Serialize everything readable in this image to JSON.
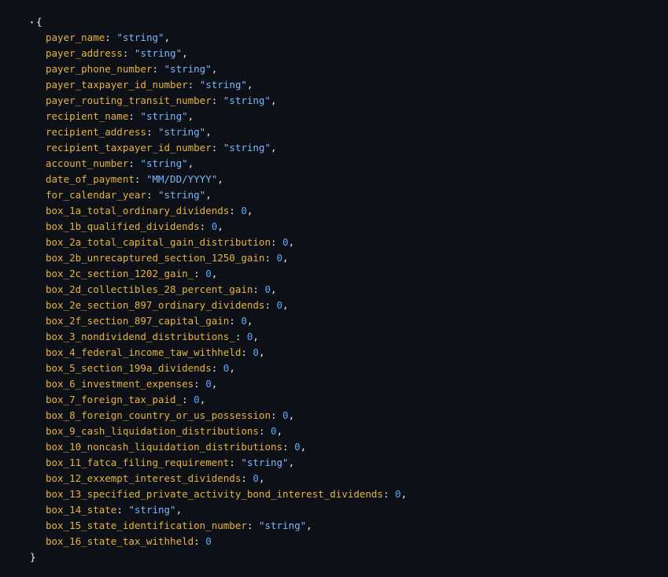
{
  "viewer": {
    "toggle_icon": "caret-down-icon",
    "open_brace": "{",
    "close_brace": "}",
    "properties": [
      {
        "key": "payer_name",
        "value": "\"string\"",
        "type": "string"
      },
      {
        "key": "payer_address",
        "value": "\"string\"",
        "type": "string"
      },
      {
        "key": "payer_phone_number",
        "value": "\"string\"",
        "type": "string"
      },
      {
        "key": "payer_taxpayer_id_number",
        "value": "\"string\"",
        "type": "string"
      },
      {
        "key": "payer_routing_transit_number",
        "value": "\"string\"",
        "type": "string"
      },
      {
        "key": "recipient_name",
        "value": "\"string\"",
        "type": "string"
      },
      {
        "key": "recipient_address",
        "value": "\"string\"",
        "type": "string"
      },
      {
        "key": "recipient_taxpayer_id_number",
        "value": "\"string\"",
        "type": "string"
      },
      {
        "key": "account_number",
        "value": "\"string\"",
        "type": "string"
      },
      {
        "key": "date_of_payment",
        "value": "\"MM/DD/YYYY\"",
        "type": "string"
      },
      {
        "key": "for_calendar_year",
        "value": "\"string\"",
        "type": "string"
      },
      {
        "key": "box_1a_total_ordinary_dividends",
        "value": "0",
        "type": "number"
      },
      {
        "key": "box_1b_qualified_dividends",
        "value": "0",
        "type": "number"
      },
      {
        "key": "box_2a_total_capital_gain_distribution",
        "value": "0",
        "type": "number"
      },
      {
        "key": "box_2b_unrecaptured_section_1250_gain",
        "value": "0",
        "type": "number"
      },
      {
        "key": "box_2c_section_1202_gain_",
        "value": "0",
        "type": "number"
      },
      {
        "key": "box_2d_collectibles_28_percent_gain",
        "value": "0",
        "type": "number"
      },
      {
        "key": "box_2e_section_897_ordinary_dividends",
        "value": "0",
        "type": "number"
      },
      {
        "key": "box_2f_section_897_capital_gain",
        "value": "0",
        "type": "number"
      },
      {
        "key": "box_3_nondividend_distributions_",
        "value": "0",
        "type": "number"
      },
      {
        "key": "box_4_federal_income_taw_withheld",
        "value": "0",
        "type": "number"
      },
      {
        "key": "box_5_section_199a_dividends",
        "value": "0",
        "type": "number"
      },
      {
        "key": "box_6_investment_expenses",
        "value": "0",
        "type": "number"
      },
      {
        "key": "box_7_foreign_tax_paid_",
        "value": "0",
        "type": "number"
      },
      {
        "key": "box_8_foreign_country_or_us_possession",
        "value": "0",
        "type": "number"
      },
      {
        "key": "box_9_cash_liquidation_distributions",
        "value": "0",
        "type": "number"
      },
      {
        "key": "box_10_noncash_liquidation_distributions",
        "value": "0",
        "type": "number"
      },
      {
        "key": "box_11_fatca_filing_requirement",
        "value": "\"string\"",
        "type": "string"
      },
      {
        "key": "box_12_exxempt_interest_dividends",
        "value": "0",
        "type": "number"
      },
      {
        "key": "box_13_specified_private_activity_bond_interest_dividends",
        "value": "0",
        "type": "number"
      },
      {
        "key": "box_14_state",
        "value": "\"string\"",
        "type": "string"
      },
      {
        "key": "box_15_state_identification_number",
        "value": "\"string\"",
        "type": "string"
      },
      {
        "key": "box_16_state_tax_withheld",
        "value": "0",
        "type": "number"
      }
    ]
  }
}
